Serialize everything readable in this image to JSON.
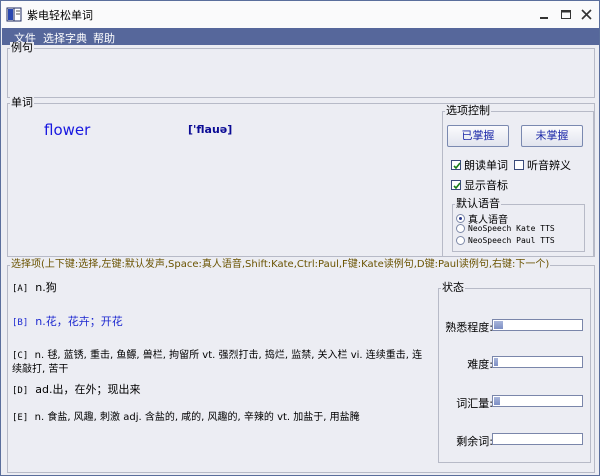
{
  "window": {
    "title": "紫电轻松单词"
  },
  "menu": [
    "文件",
    "选择字典",
    "帮助"
  ],
  "example": {
    "label": "例句"
  },
  "word": {
    "label": "单词",
    "text": "flower",
    "phonetic": "['flauə]"
  },
  "options": {
    "label": "选项控制",
    "mastered_button": "已掌握",
    "unmastered_button": "未掌握",
    "read_word": {
      "label": "朗读单词",
      "checked": true
    },
    "listen_mode": {
      "label": "听音辨义",
      "checked": false
    },
    "show_phonetic": {
      "label": "显示音标",
      "checked": true
    },
    "voice": {
      "label": "默认语音",
      "options": [
        {
          "label": "真人语音",
          "selected": true
        },
        {
          "label": "NeoSpeech Kate TTS",
          "selected": false
        },
        {
          "label": "NeoSpeech Paul TTS",
          "selected": false
        }
      ]
    }
  },
  "choices": {
    "label": "选择项(上下键:选择,左键:默认发声,Space:真人语音,Shift:Kate,Ctrl:Paul,F键:Kate读例句,D键:Paul读例句,右键:下一个)",
    "items": [
      {
        "key": "[A]",
        "text": "n.狗"
      },
      {
        "key": "[B]",
        "text": "n.花，花卉；开花"
      },
      {
        "key": "[C]",
        "text": "n. 毬, 蓝锈, 重击, 鱼鳔, 兽栏, 拘留所 vt. 强烈打击, 捣烂, 监禁, 关入栏 vi. 连续重击, 连续敲打, 苦干"
      },
      {
        "key": "[D]",
        "text": "ad.出，在外；现出来"
      },
      {
        "key": "[E]",
        "text": "n. 食盐, 风趣, 刺激 adj. 含盐的, 咸的, 风趣的, 辛辣的 vt. 加盐于, 用盐腌"
      }
    ]
  },
  "status": {
    "label": "状态",
    "items": [
      {
        "label": "熟悉程度:",
        "fill": 0.1
      },
      {
        "label": "难度:",
        "fill": 0.05
      },
      {
        "label": "词汇量:",
        "fill": 0.07
      },
      {
        "label": "剩余词:",
        "fill": 0.0
      }
    ]
  },
  "colors": {
    "menubar": "#56679b",
    "window_bg": "#ecedf3",
    "word": "#1818e0",
    "selected_choice": "#1c28d0"
  }
}
